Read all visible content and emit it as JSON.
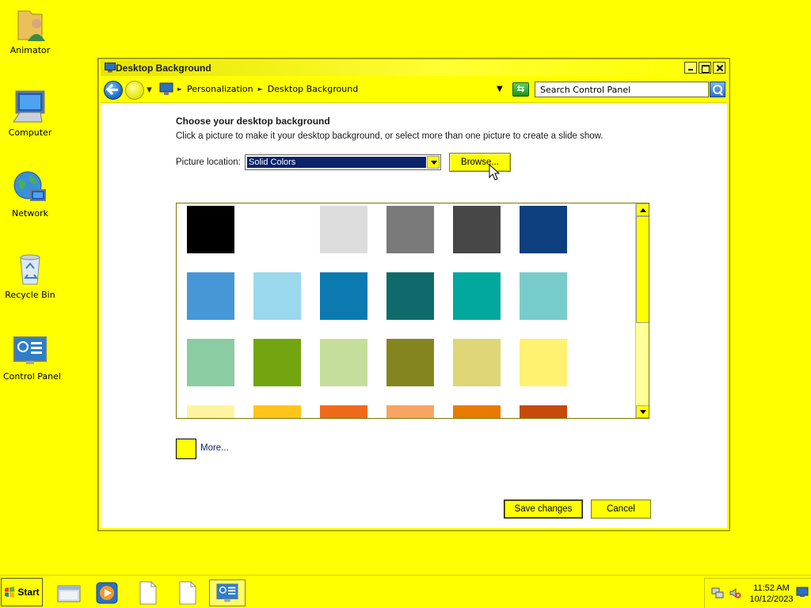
{
  "desktop": {
    "icons": [
      {
        "label": "Animator",
        "icon": "user-folder-icon"
      },
      {
        "label": "Computer",
        "icon": "computer-icon"
      },
      {
        "label": "Network",
        "icon": "network-globe-icon"
      },
      {
        "label": "Recycle Bin",
        "icon": "recycle-bin-icon"
      },
      {
        "label": "Control Panel",
        "icon": "control-panel-icon"
      }
    ]
  },
  "window": {
    "title": "Desktop Background",
    "breadcrumb": [
      "Personalization",
      "Desktop Background"
    ],
    "search_placeholder": "Search Control Panel",
    "heading": "Choose your desktop background",
    "subtext": "Click a picture to make it your desktop background, or select more than one picture to create a slide show.",
    "picture_location_label": "Picture location:",
    "picture_location_value": "Solid Colors",
    "browse_label": "Browse...",
    "swatches": [
      "#000000",
      "#ffffff",
      "#dcdcdc",
      "#7a7a7a",
      "#474747",
      "#0e3f7e",
      "#4597d8",
      "#9ad8ee",
      "#0a7ab0",
      "#0f6b6b",
      "#00a89e",
      "#79cccc",
      "#8ccca2",
      "#72a50f",
      "#c6de9c",
      "#858520",
      "#ded677",
      "#fff270",
      "#fff3a0",
      "#ffc51a",
      "#ee6a1a",
      "#f8a462",
      "#e87a00",
      "#c74a0c"
    ],
    "more_label": "More...",
    "more_color": "#ffff00",
    "save_label": "Save changes",
    "cancel_label": "Cancel"
  },
  "taskbar": {
    "start_label": "Start",
    "pinned": [
      "explorer-icon",
      "media-player-icon",
      "document-icon",
      "document-icon",
      "control-panel-icon"
    ],
    "tray_icons": [
      "network-status-icon",
      "volume-muted-icon"
    ],
    "time": "11:52 AM",
    "date": "10/12/2023"
  },
  "colors": {
    "accent": "#ffff00",
    "selection": "#0a246a"
  }
}
